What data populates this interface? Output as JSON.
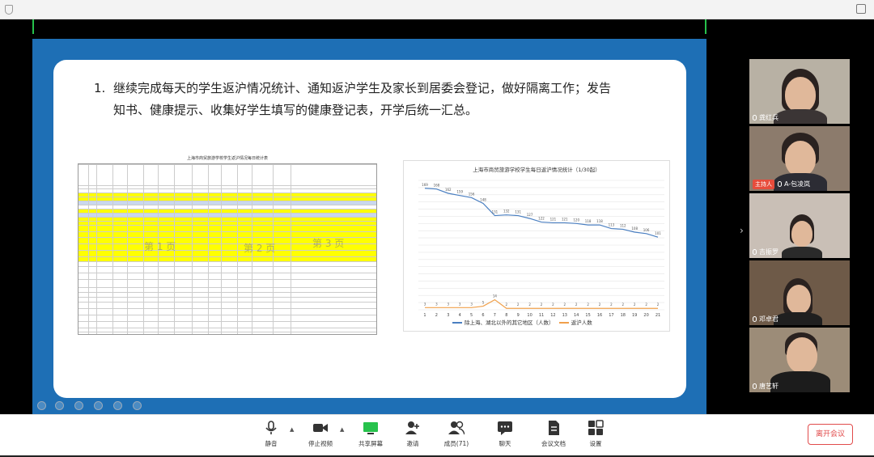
{
  "slide": {
    "headline_num": "1.",
    "headline_line1": "继续完成每天的学生返沪情况统计、通知返沪学生及家长到居委会登记，做好隔离工作；发告",
    "headline_line2": "知书、健康提示、收集好学生填写的健康登记表，开学后统一汇总。",
    "table_title": "上海市商贸旅游学校学生返沪情况每日统计表",
    "watermark1": "第 1 页",
    "watermark2": "第 2 页",
    "watermark3": "第 3 页"
  },
  "chart_data": {
    "type": "line",
    "title": "上海市商贸旅游学校学生每日返沪情况统计（1/30起）",
    "x": [
      "1",
      "2",
      "3",
      "4",
      "5",
      "6",
      "7",
      "8",
      "9",
      "10",
      "11",
      "12",
      "13",
      "14",
      "15",
      "16",
      "17",
      "18",
      "19",
      "20",
      "21"
    ],
    "series": [
      {
        "name": "除上海、湖北以外的其它地区（人数）",
        "color": "#4a7fc1",
        "values": [
          169,
          168,
          162,
          159,
          156,
          148,
          131,
          132,
          131,
          127,
          122,
          121,
          121,
          120,
          118,
          118,
          113,
          112,
          108,
          106,
          101
        ],
        "labels": [
          "169",
          "168",
          "162",
          "159",
          "156",
          "148",
          "131",
          "132",
          "131",
          "127",
          "122",
          "121",
          "121",
          "120",
          "118",
          "118",
          "113",
          "112",
          "108",
          "106",
          "101"
        ]
      },
      {
        "name": "返沪人数",
        "color": "#f0a04b",
        "values": [
          3,
          3,
          3,
          3,
          3,
          5,
          14,
          2,
          2,
          2,
          2,
          2,
          2,
          2,
          2,
          2,
          2,
          2,
          2,
          2,
          2
        ],
        "labels": [
          "3",
          "3",
          "3",
          "3",
          "3",
          "5",
          "14",
          "2",
          "2",
          "2",
          "2",
          "2",
          "2",
          "2",
          "2",
          "2",
          "2",
          "2",
          "2",
          "2",
          "2"
        ]
      }
    ],
    "ylim": [
      0,
      180
    ]
  },
  "participants": [
    {
      "name": "龚红兵",
      "host": false
    },
    {
      "name": "A-包凌岚",
      "host": true,
      "host_label": "主持人"
    },
    {
      "name": "吉振罗",
      "host": false
    },
    {
      "name": "邓卓君",
      "host": false
    },
    {
      "name": "唐艺轩",
      "host": false
    }
  ],
  "toolbar": {
    "mute": "静音",
    "stop_video": "停止视频",
    "share": "共享屏幕",
    "invite": "邀请",
    "members": "成员(71)",
    "chat": "聊天",
    "docs": "会议文档",
    "settings": "设置",
    "leave": "离开会议"
  },
  "colors": {
    "slide_bg": "#1e6fb5",
    "leave": "#e14b4b",
    "share_active": "#27c24c"
  }
}
